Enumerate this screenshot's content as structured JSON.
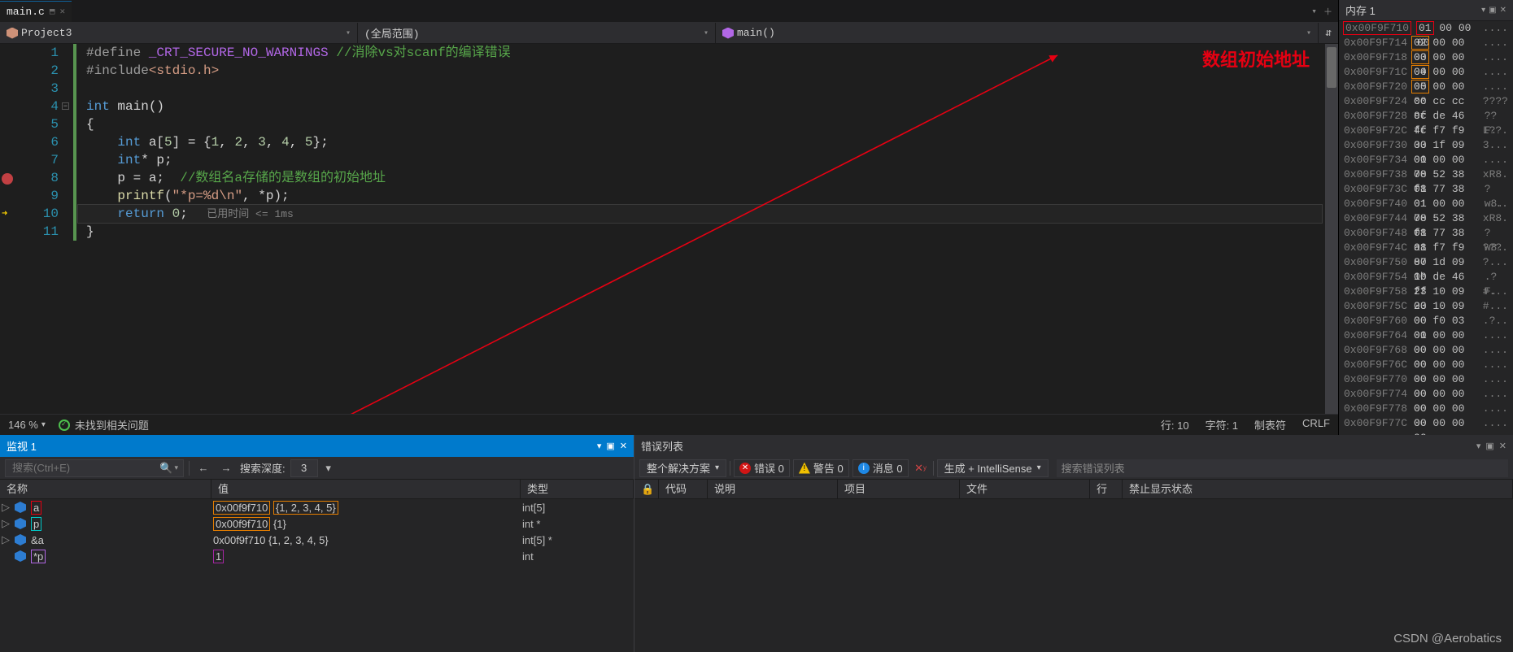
{
  "tab": {
    "name": "main.c"
  },
  "nav": {
    "project": "Project3",
    "scope": "(全局范围)",
    "func": "main()"
  },
  "lines": {
    "l1_a": "#define ",
    "l1_b": "_CRT_SECURE_NO_WARNINGS",
    "l1_c": " //消除vs对scanf的编译错误",
    "l2_a": "#include",
    "l2_b": "<stdio.h>",
    "l4_a": "int",
    "l4_b": " main()",
    "l5": "{",
    "l6_a": "    int",
    "l6_b": " a[",
    "l6_c": "5",
    "l6_d": "] = {",
    "l6_e": "1",
    "l6_f": ", ",
    "l6_g": "2",
    "l6_h": ", ",
    "l6_i": "3",
    "l6_j": ", ",
    "l6_k": "4",
    "l6_l": ", ",
    "l6_m": "5",
    "l6_n": "};",
    "l7_a": "    int",
    "l7_b": "* p;",
    "l8_a": "    p = a;  ",
    "l8_b": "//数组名a存储的是数组的初始地址",
    "l9_a": "    printf",
    "l9_b": "(",
    "l9_c": "\"*p=%d\\n\"",
    "l9_d": ", *p);",
    "l10_a": "    return ",
    "l10_b": "0",
    "l10_c": ";",
    "l10_d": "   已用时间 <= 1ms",
    "l11": "}",
    "nums": [
      "1",
      "2",
      "3",
      "4",
      "5",
      "6",
      "7",
      "8",
      "9",
      "10",
      "11"
    ]
  },
  "annotation": "数组初始地址",
  "status": {
    "zoom": "146 %",
    "issues": "未找到相关问题",
    "line": "行: 10",
    "col": "字符: 1",
    "tab": "制表符",
    "eol": "CRLF"
  },
  "memory": {
    "title": "内存 1",
    "rows": [
      {
        "addr": "0x00F9F710",
        "h": [
          "01",
          "00 00 00"
        ],
        "a": "....",
        "hl": "red"
      },
      {
        "addr": "0x00F9F714",
        "h": [
          "02",
          "00 00 00"
        ],
        "a": "....",
        "hl": "org"
      },
      {
        "addr": "0x00F9F718",
        "h": [
          "03",
          "00 00 00"
        ],
        "a": "....",
        "hl": "org"
      },
      {
        "addr": "0x00F9F71C",
        "h": [
          "04",
          "00 00 00"
        ],
        "a": "....",
        "hl": "org"
      },
      {
        "addr": "0x00F9F720",
        "h": [
          "05",
          "00 00 00"
        ],
        "a": "....",
        "hl": "org"
      },
      {
        "addr": "0x00F9F724",
        "h": [
          "cc cc cc cc"
        ],
        "a": "????"
      },
      {
        "addr": "0x00F9F728",
        "h": [
          "9f de 46 ff"
        ],
        "a": "??F."
      },
      {
        "addr": "0x00F9F72C",
        "h": [
          "4c f7 f9 00"
        ],
        "a": "L??."
      },
      {
        "addr": "0x00F9F730",
        "h": [
          "33 1f 09 00"
        ],
        "a": "3..."
      },
      {
        "addr": "0x00F9F734",
        "h": [
          "01 00 00 00"
        ],
        "a": "...."
      },
      {
        "addr": "0x00F9F738",
        "h": [
          "78 52 38 01"
        ],
        "a": "xR8."
      },
      {
        "addr": "0x00F9F73C",
        "h": [
          "f8 77 38 01"
        ],
        "a": "?w8."
      },
      {
        "addr": "0x00F9F740",
        "h": [
          "01 00 00 00"
        ],
        "a": "...."
      },
      {
        "addr": "0x00F9F744",
        "h": [
          "78 52 38 01"
        ],
        "a": "xR8."
      },
      {
        "addr": "0x00F9F748",
        "h": [
          "f8 77 38 01"
        ],
        "a": "?w8."
      },
      {
        "addr": "0x00F9F74C",
        "h": [
          "a8 f7 f9 00"
        ],
        "a": "???."
      },
      {
        "addr": "0x00F9F750",
        "h": [
          "87 1d 09 00"
        ],
        "a": "?..."
      },
      {
        "addr": "0x00F9F754",
        "h": [
          "1b de 46 ff"
        ],
        "a": ".?F."
      },
      {
        "addr": "0x00F9F758",
        "h": [
          "23 10 09 00"
        ],
        "a": "#..."
      },
      {
        "addr": "0x00F9F75C",
        "h": [
          "23 10 09 00"
        ],
        "a": "#..."
      },
      {
        "addr": "0x00F9F760",
        "h": [
          "00 f0 03 01"
        ],
        "a": ".?.."
      },
      {
        "addr": "0x00F9F764",
        "h": [
          "00 00 00 00"
        ],
        "a": "...."
      },
      {
        "addr": "0x00F9F768",
        "h": [
          "00 00 00 00"
        ],
        "a": "...."
      },
      {
        "addr": "0x00F9F76C",
        "h": [
          "00 00 00 00"
        ],
        "a": "...."
      },
      {
        "addr": "0x00F9F770",
        "h": [
          "00 00 00 00"
        ],
        "a": "...."
      },
      {
        "addr": "0x00F9F774",
        "h": [
          "00 00 00 00"
        ],
        "a": "...."
      },
      {
        "addr": "0x00F9F778",
        "h": [
          "00 00 00 00"
        ],
        "a": "...."
      },
      {
        "addr": "0x00F9F77C",
        "h": [
          "00 00 00 00"
        ],
        "a": "...."
      }
    ]
  },
  "watch": {
    "title": "监视 1",
    "search_ph": "搜索(Ctrl+E)",
    "depth_label": "搜索深度:",
    "depth": "3",
    "cols": {
      "name": "名称",
      "val": "值",
      "type": "类型"
    },
    "rows": [
      {
        "exp": true,
        "name": "a",
        "val_a": "0x00f9f710",
        "val_b": "{1, 2, 3, 4, 5}",
        "type": "int[5]",
        "hl": "red-org"
      },
      {
        "exp": true,
        "name": "p",
        "val_a": "0x00f9f710",
        "val_b": "{1}",
        "type": "int *",
        "hl": "cyan-org"
      },
      {
        "exp": true,
        "name": "&a",
        "val": "0x00f9f710 {1, 2, 3, 4, 5}",
        "type": "int[5] *"
      },
      {
        "exp": false,
        "name": "*p",
        "val": "1",
        "type": "int",
        "hl": "pur-mag"
      }
    ]
  },
  "errlist": {
    "title": "错误列表",
    "scope": "整个解决方案",
    "err": "错误 0",
    "warn": "警告 0",
    "info": "消息 0",
    "build": "生成 + IntelliSense",
    "search_ph": "搜索错误列表",
    "cols": {
      "code": "代码",
      "desc": "说明",
      "proj": "项目",
      "file": "文件",
      "line": "行",
      "sup": "禁止显示状态"
    }
  },
  "watermark": "CSDN @Aerobatics"
}
